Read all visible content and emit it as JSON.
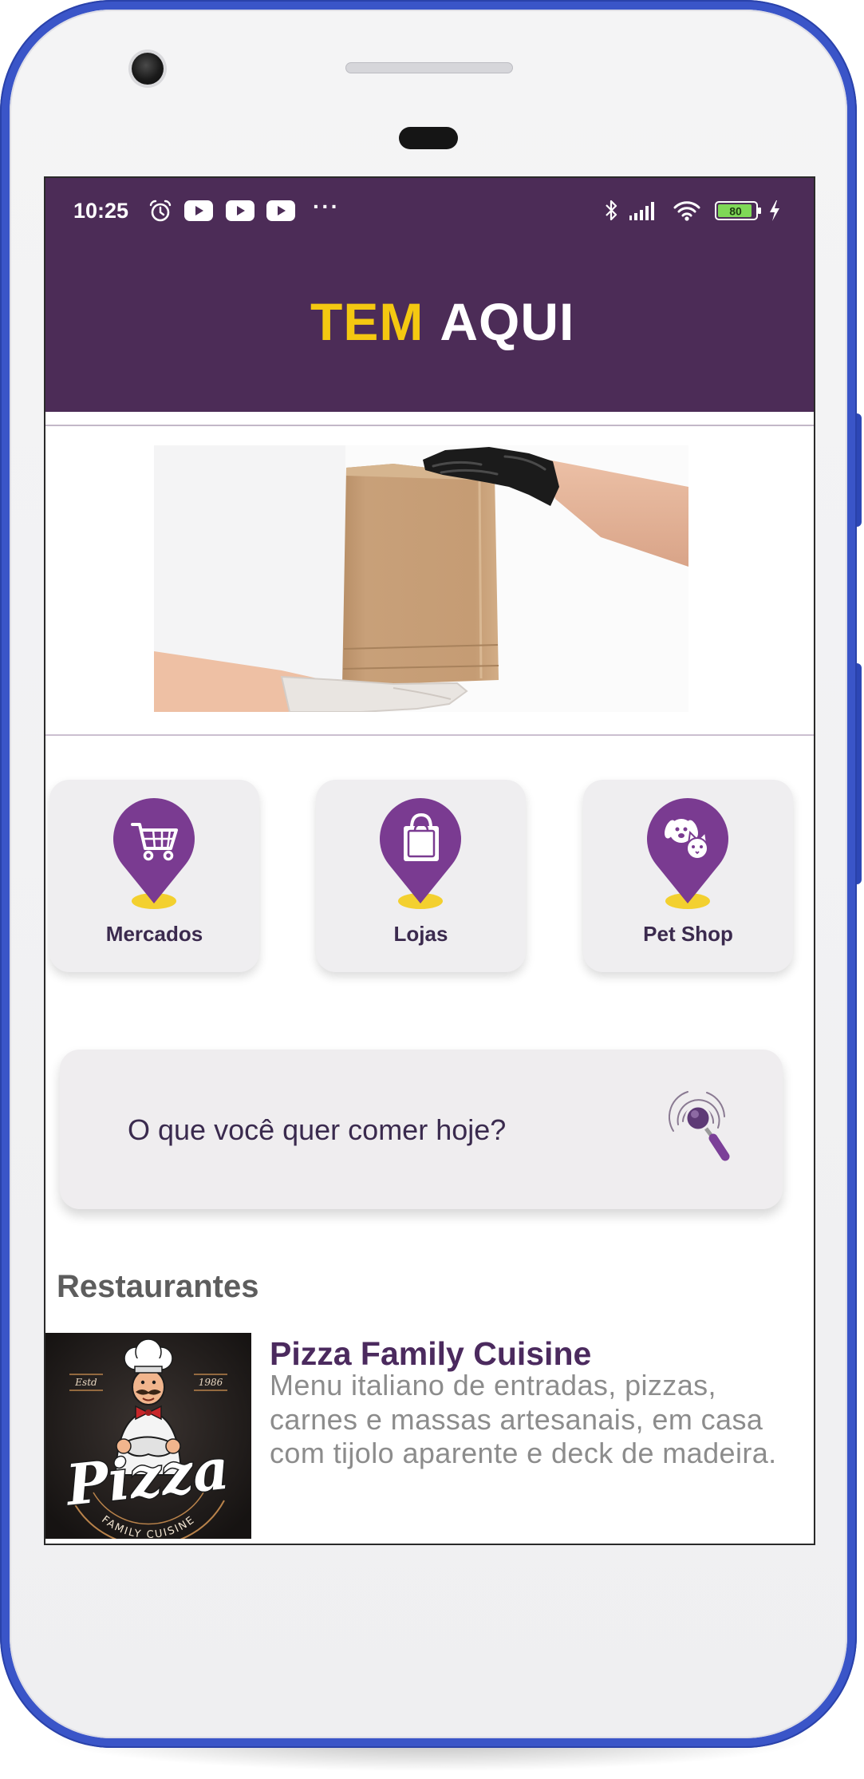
{
  "status_bar": {
    "time": "10:25",
    "overflow": "···",
    "battery_level": "80",
    "icons": [
      "alarm-icon",
      "youtube-icon",
      "youtube-icon",
      "youtube-icon",
      "bluetooth-icon",
      "signal-icon",
      "wifi-icon",
      "battery-icon",
      "charging-icon"
    ]
  },
  "header": {
    "title_highlight": "TEM",
    "title_rest": "AQUI"
  },
  "categories": [
    {
      "label": "Mercados",
      "icon": "cart-icon"
    },
    {
      "label": "Lojas",
      "icon": "shopping-bag-icon"
    },
    {
      "label": "Pet Shop",
      "icon": "pet-icon"
    }
  ],
  "search": {
    "placeholder": "O que você quer comer hoje?",
    "icon": "search-icon"
  },
  "restaurants": {
    "heading": "Restaurantes",
    "items": [
      {
        "name": "Pizza Family Cuisine",
        "description": "Menu italiano de entradas, pizzas, carnes e massas artesanais, em casa com tijolo aparente e deck de madeira.",
        "logo_text": {
          "script": "Pizza",
          "estd": "Estd",
          "year": "1986",
          "tagline": "FAMILY CUISINE"
        }
      }
    ]
  },
  "theme": {
    "header_bg": "#4c2c57",
    "title_highlight": "#f4c811",
    "pin_purple": "#7a3b91",
    "pin_base_yellow": "#f3d02f",
    "card_bg": "#efeef0",
    "phone_frame": "#3a55c8"
  }
}
